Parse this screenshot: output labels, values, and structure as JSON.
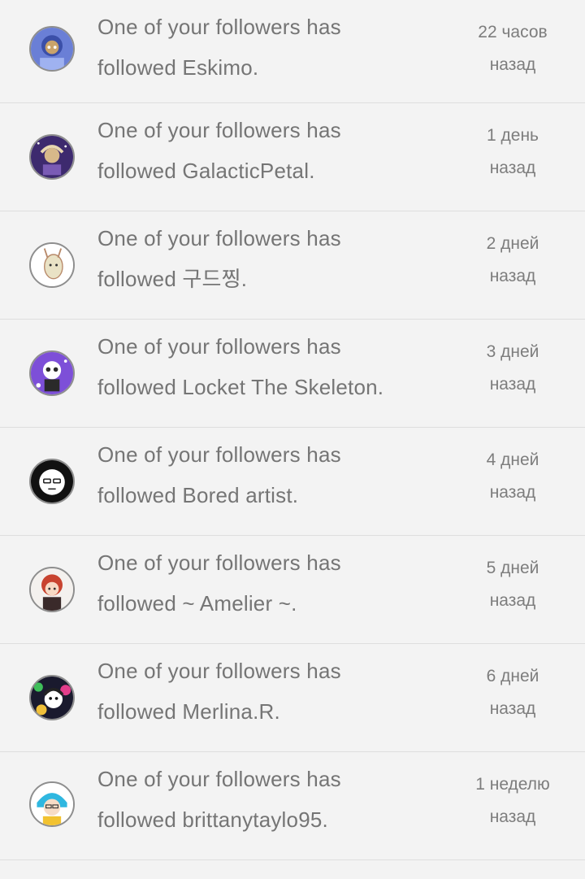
{
  "notifications": [
    {
      "line1": "One of your followers has",
      "line2": "followed Eskimo.",
      "time1": "22 часов",
      "time2": "назад",
      "avatar_icon": "avatar-eskimo-icon",
      "avatar_colors": [
        "#6a7fd6",
        "#c9a36b",
        "#3b4fa8"
      ]
    },
    {
      "line1": "One of your followers has",
      "line2": "followed GalacticPetal.",
      "time1": "1 день",
      "time2": "назад",
      "avatar_icon": "avatar-galacticpetal-icon",
      "avatar_colors": [
        "#3d2a6e",
        "#d7b98a",
        "#7a5bb5"
      ]
    },
    {
      "line1": "One of your followers has",
      "line2": "followed 구드찡.",
      "time1": "2 дней",
      "time2": "назад",
      "avatar_icon": "avatar-gudeujjing-icon",
      "avatar_colors": [
        "#ffffff",
        "#b88a6a",
        "#e9e2c5"
      ]
    },
    {
      "line1": "One of your followers has",
      "line2": "followed Locket The Skeleton.",
      "time1": "3 дней",
      "time2": "назад",
      "avatar_icon": "avatar-locket-icon",
      "avatar_colors": [
        "#7d4fd8",
        "#ffffff",
        "#2a2a2a"
      ]
    },
    {
      "line1": "One of your followers has",
      "line2": "followed Bored artist.",
      "time1": "4 дней",
      "time2": "назад",
      "avatar_icon": "avatar-bored-artist-icon",
      "avatar_colors": [
        "#111111",
        "#ffffff",
        "#111111"
      ]
    },
    {
      "line1": "One of your followers has",
      "line2": "followed ~ Amelier ~.",
      "time1": "5 дней",
      "time2": "назад",
      "avatar_icon": "avatar-amelier-icon",
      "avatar_colors": [
        "#f4f1ee",
        "#c8432f",
        "#3a2a2a"
      ]
    },
    {
      "line1": "One of your followers has",
      "line2": "followed Merlina.R.",
      "time1": "6 дней",
      "time2": "назад",
      "avatar_icon": "avatar-merlina-icon",
      "avatar_colors": [
        "#1a1a2e",
        "#e23d8b",
        "#3fbf5a"
      ]
    },
    {
      "line1": "One of your followers has",
      "line2": "followed brittanytaylo95.",
      "time1": "1 неделю",
      "time2": "назад",
      "avatar_icon": "avatar-brittanytaylo95-icon",
      "avatar_colors": [
        "#ffffff",
        "#2fb7e0",
        "#f2c230"
      ]
    }
  ]
}
